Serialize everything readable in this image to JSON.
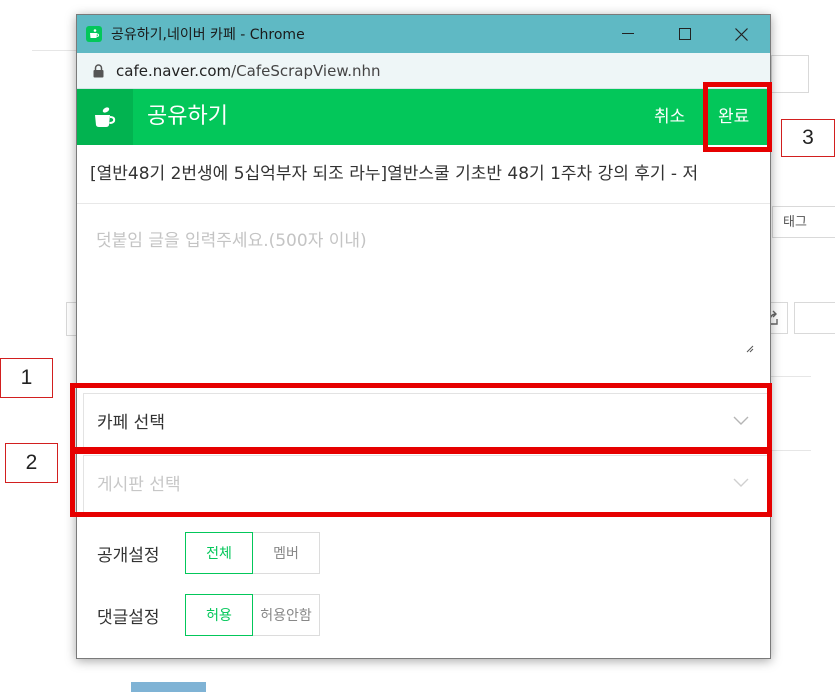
{
  "window": {
    "title": "공유하기,네이버 카페 - Chrome",
    "url_host": "cafe.naver.com",
    "url_path": "/CafeScrapView.nhn"
  },
  "header": {
    "title": "공유하기",
    "cancel_label": "취소",
    "done_label": "완료"
  },
  "article_title": "[열반48기 2번생에 5십억부자 되조 라누]열반스쿨 기초반 48기 1주차 강의 후기 - 저",
  "comment": {
    "placeholder": "덧붙임 글을 입력주세요.(500자 이내)"
  },
  "cafe_select": {
    "label": "카페 선택"
  },
  "board_select": {
    "label": "게시판 선택"
  },
  "visibility": {
    "label": "공개설정",
    "options": [
      "전체",
      "멤버"
    ],
    "selected": "전체"
  },
  "comments_setting": {
    "label": "댓글설정",
    "options": [
      "허용",
      "허용안함"
    ],
    "selected": "허용"
  },
  "background": {
    "tag_label": "태그"
  },
  "annotations": [
    "1",
    "2",
    "3"
  ],
  "colors": {
    "brand": "#03c75a",
    "titlebar": "#5fb9c4",
    "highlight": "#e60000"
  }
}
